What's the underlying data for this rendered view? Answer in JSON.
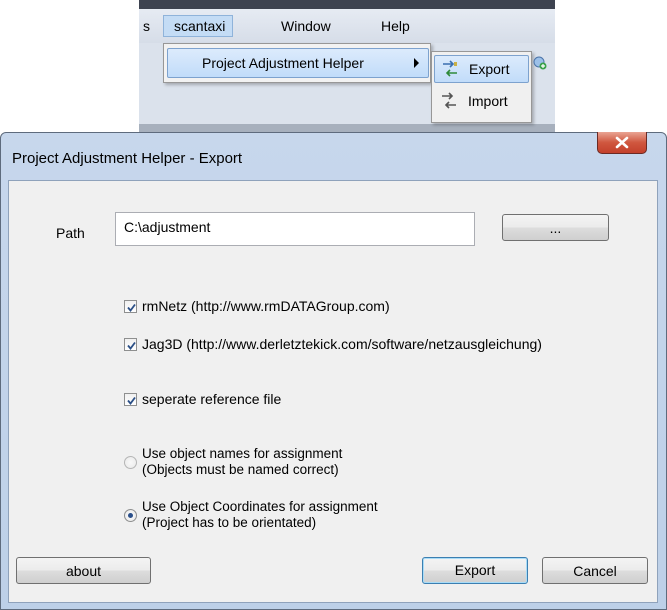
{
  "menubar": {
    "partial_item": "s",
    "items": [
      "scantaxi",
      "Window",
      "Help"
    ]
  },
  "dropdown": {
    "item_label": "Project Adjustment Helper"
  },
  "submenu": {
    "export_label": "Export",
    "import_label": "Import"
  },
  "dialog": {
    "title": "Project Adjustment Helper - Export",
    "path_label": "Path",
    "path_value": "C:\\adjustment",
    "browse_label": "...",
    "checkboxes": [
      {
        "label": "rmNetz (http://www.rmDATAGroup.com)",
        "checked": true
      },
      {
        "label": "Jag3D (http://www.derletztekick.com/software/netzausgleichung)",
        "checked": true
      },
      {
        "label": "seperate reference file",
        "checked": true
      }
    ],
    "radios": [
      {
        "line1": "Use object names for assignment",
        "line2": "(Objects must be named correct)",
        "selected": false
      },
      {
        "line1": "Use Object Coordinates for assignment",
        "line2": "(Project has to be orientated)",
        "selected": true
      }
    ],
    "about_label": "about",
    "export_label": "Export",
    "cancel_label": "Cancel"
  },
  "colors": {
    "accent_selection": "#c1dcfa",
    "close_button": "#c3402b",
    "dialog_frame": "#bdd0e8"
  }
}
